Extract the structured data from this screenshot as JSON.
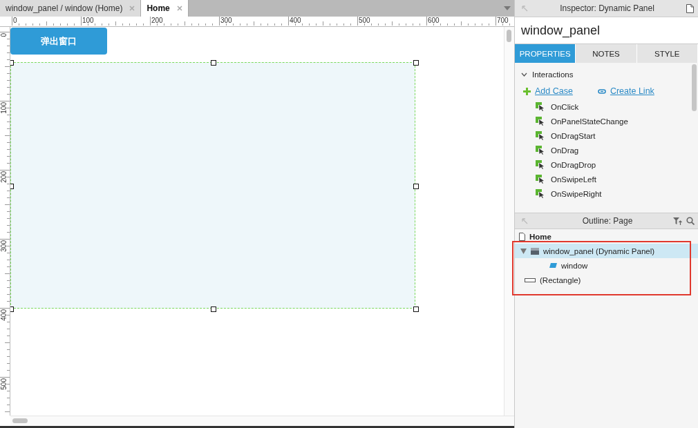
{
  "document_tabs": [
    {
      "label": "window_panel / window (Home)",
      "selected": false
    },
    {
      "label": "Home",
      "selected": true
    }
  ],
  "rulers": {
    "x_labels": [
      "0",
      "100",
      "200",
      "300",
      "400",
      "500",
      "600",
      "700"
    ],
    "y_labels": [
      "0",
      "100",
      "200",
      "300",
      "400",
      "500"
    ]
  },
  "canvas": {
    "button": {
      "label": "弹出窗口"
    },
    "panel": {
      "selected": true
    }
  },
  "inspector": {
    "title": "Inspector: Dynamic Panel",
    "widget_name": "window_panel",
    "tabs": [
      {
        "label": "PROPERTIES",
        "selected": true
      },
      {
        "label": "NOTES",
        "selected": false
      },
      {
        "label": "STYLE",
        "selected": false
      }
    ],
    "section": {
      "label": "Interactions",
      "expanded": true
    },
    "actions": [
      {
        "label": "Add Case",
        "kind": "add"
      },
      {
        "label": "Create Link",
        "kind": "link"
      }
    ],
    "events": [
      "OnClick",
      "OnPanelStateChange",
      "OnDragStart",
      "OnDrag",
      "OnDragDrop",
      "OnSwipeLeft",
      "OnSwipeRight"
    ]
  },
  "outline": {
    "title": "Outline: Page",
    "page": "Home",
    "items": [
      {
        "label": "window_panel (Dynamic Panel)",
        "kind": "dynamic-panel",
        "selected": true,
        "expanded": true,
        "children": [
          {
            "label": "window",
            "kind": "state",
            "selected": false
          }
        ]
      },
      {
        "label": "(Rectangle)",
        "kind": "rectangle",
        "selected": false
      }
    ]
  }
}
